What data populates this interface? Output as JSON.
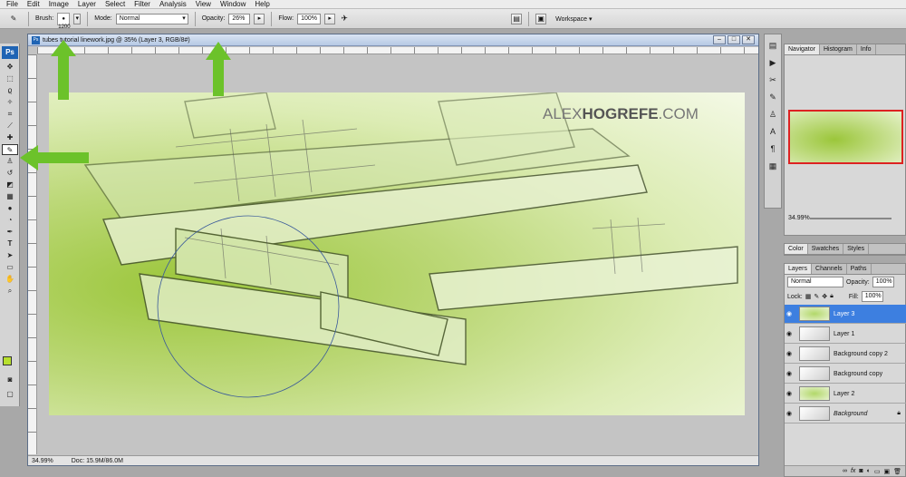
{
  "menu": [
    "File",
    "Edit",
    "Image",
    "Layer",
    "Select",
    "Filter",
    "Analysis",
    "View",
    "Window",
    "Help"
  ],
  "options": {
    "brush_label": "Brush:",
    "brush_size": "1200",
    "mode_label": "Mode:",
    "mode_value": "Normal",
    "opacity_label": "Opacity:",
    "opacity_value": "26%",
    "flow_label": "Flow:",
    "flow_value": "100%",
    "workspace_label": "Workspace"
  },
  "tools": {
    "logo": "Ps",
    "items": [
      "move-icon",
      "marquee-icon",
      "lasso-icon",
      "quick-select-icon",
      "crop-icon",
      "eyedropper-icon",
      "healing-icon",
      "brush-icon",
      "stamp-icon",
      "history-brush-icon",
      "eraser-icon",
      "gradient-icon",
      "blur-icon",
      "dodge-icon",
      "pen-icon",
      "type-icon",
      "path-select-icon",
      "shape-icon",
      "hand-icon",
      "zoom-icon"
    ],
    "active": "brush-icon",
    "foreground_color": "#b8e02e",
    "background_color": "#111111"
  },
  "document": {
    "title": "tubes tutorial linework.jpg @ 35% (Layer 3, RGB/8#)",
    "zoom": "34.99%",
    "doc_size": "Doc: 15.9M/86.0M",
    "watermark_light": "ALEX",
    "watermark_bold": "HOGREFE",
    "watermark_suffix": ".COM"
  },
  "navigator": {
    "tabs": [
      "Navigator",
      "Histogram",
      "Info"
    ],
    "zoom": "34.99%"
  },
  "color_panel": {
    "tabs": [
      "Color",
      "Swatches",
      "Styles"
    ]
  },
  "layers_panel": {
    "tabs": [
      "Layers",
      "Channels",
      "Paths"
    ],
    "blend_mode": "Normal",
    "opacity_label": "Opacity:",
    "opacity_value": "100%",
    "lock_label": "Lock:",
    "fill_label": "Fill:",
    "fill_value": "100%",
    "layers": [
      "Layer 3",
      "Layer 1",
      "Background copy 2",
      "Background copy",
      "Layer 2",
      "Background"
    ],
    "selected": "Layer 3"
  },
  "colors": {
    "annotation_arrow": "#6cc22a",
    "selected_layer": "#3d7fe0"
  }
}
